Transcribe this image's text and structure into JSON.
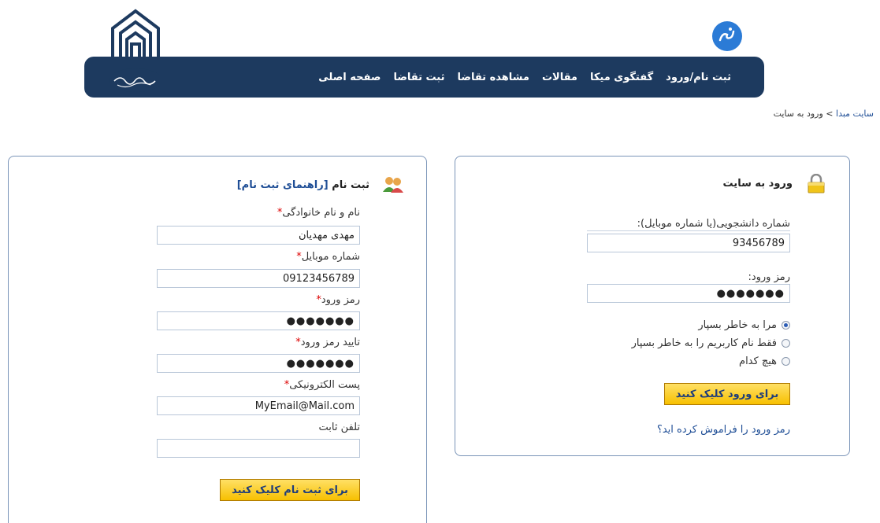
{
  "header": {
    "nav": [
      {
        "label": "صفحه اصلی"
      },
      {
        "label": "ثبت تقاضا"
      },
      {
        "label": "مشاهده تقاضا"
      },
      {
        "label": "مقالات"
      },
      {
        "label": "گفتگوی میکا"
      },
      {
        "label": "ثبت نام/ورود"
      }
    ],
    "brand_color": "#1d3a5f",
    "mika_color": "#2b7bd6"
  },
  "breadcrumb": {
    "home": "سایت مبدا",
    "separator": " > ",
    "current": "ورود به سایت"
  },
  "login": {
    "title": "ورود به سایت",
    "username_label": "شماره دانشجویی(یا شماره موبایل):",
    "username_value": "93456789",
    "password_label": "رمز ورود:",
    "password_value": "●●●●●●●",
    "remember_options": [
      {
        "label": "مرا به خاطر بسپار",
        "selected": true
      },
      {
        "label": "فقط نام کاربریم را به خاطر بسپار",
        "selected": false
      },
      {
        "label": "هیچ کدام",
        "selected": false
      }
    ],
    "submit_label": "برای ورود کلیک کنید",
    "forgot_label": "رمز ورود را فراموش کرده اید؟"
  },
  "register": {
    "title": "ثبت نام",
    "guide_label": "[راهنمای ثبت نام]",
    "required_mark": "*",
    "fields": {
      "fullname_label": "نام و نام خانوادگی",
      "fullname_value": "مهدی مهدیان",
      "mobile_label": "شماره موبایل",
      "mobile_value": "09123456789",
      "password_label": "رمز ورود",
      "password_value": "●●●●●●●",
      "confirm_label": "تایید رمز ورود",
      "confirm_value": "●●●●●●●",
      "email_label": "پست الکترونیکی",
      "email_value": "MyEmail@Mail.com",
      "phone_label": "تلفن ثابت",
      "phone_value": ""
    },
    "submit_label": "برای ثبت نام کلیک کنید"
  }
}
